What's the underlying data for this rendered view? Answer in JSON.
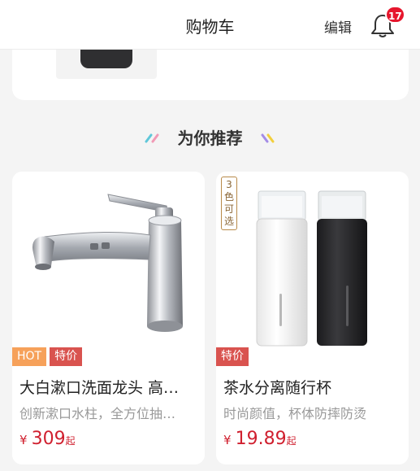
{
  "header": {
    "title": "购物车",
    "edit_label": "编辑",
    "notification_count": "17"
  },
  "recommend": {
    "title": "为你推荐"
  },
  "products": [
    {
      "tags": [
        "HOT",
        "特价"
      ],
      "name": "大白漱口洗面龙头 高…",
      "desc": "创新漱口水柱，全方位抽…",
      "currency": "¥",
      "price": "309",
      "price_suffix": "起",
      "image_icon": "faucet-image"
    },
    {
      "color_badge": "3色可选",
      "tags": [
        "特价"
      ],
      "name": "茶水分离随行杯",
      "desc": "时尚颜值，杯体防摔防烫",
      "currency": "¥",
      "price": "19.89",
      "price_suffix": "起",
      "image_icon": "tea-bottles-image"
    }
  ],
  "colors": {
    "accent": "#d0202f",
    "badge": "#e6162d",
    "hot_tag": "#f6a15a",
    "sale_tag": "#d9534f"
  }
}
